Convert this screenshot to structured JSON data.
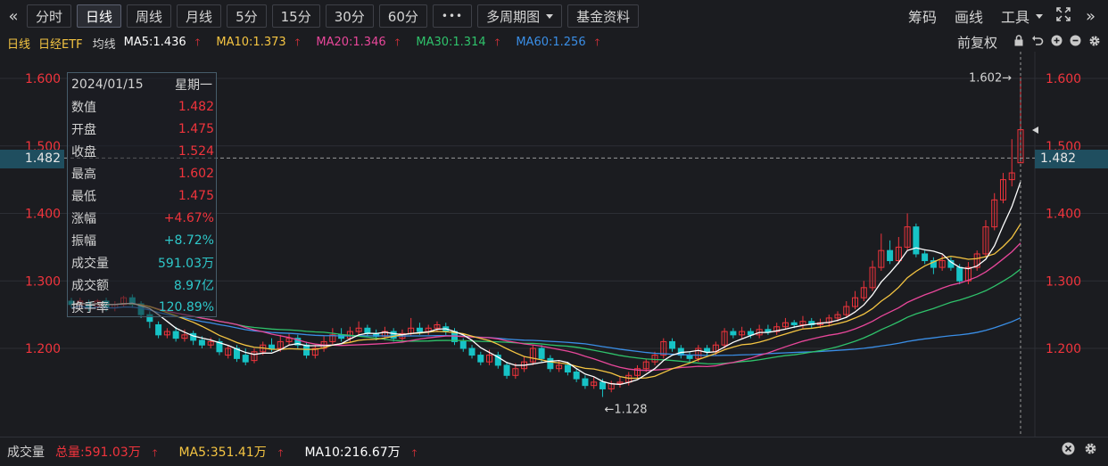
{
  "toolbar": {
    "collapse_icon": "«",
    "periods": [
      "分时",
      "日线",
      "周线",
      "月线",
      "5分",
      "15分",
      "30分",
      "60分"
    ],
    "active_period": "日线",
    "more": "•••",
    "multi_period": "多周期图",
    "fund_info": "基金资料",
    "right": [
      "筹码",
      "画线",
      "工具"
    ],
    "fullscreen_icon": "expand-icon",
    "expand_right_icon": "»"
  },
  "ma_legend": {
    "period": "日线",
    "name": "日经ETF",
    "ma_label": "均线",
    "items": [
      {
        "label": "MA5:1.436",
        "color": "#ffffff"
      },
      {
        "label": "MA10:1.373",
        "color": "#f5c542"
      },
      {
        "label": "MA20:1.346",
        "color": "#e8479a"
      },
      {
        "label": "MA30:1.314",
        "color": "#2fc26b"
      },
      {
        "label": "MA60:1.256",
        "color": "#3a8ee6"
      }
    ],
    "adjust": "前复权"
  },
  "tooltip": {
    "date": "2024/01/15",
    "weekday": "星期一",
    "rows": [
      {
        "k": "数值",
        "v": "1.482",
        "c": "red"
      },
      {
        "k": "开盘",
        "v": "1.475",
        "c": "red"
      },
      {
        "k": "收盘",
        "v": "1.524",
        "c": "red"
      },
      {
        "k": "最高",
        "v": "1.602",
        "c": "red"
      },
      {
        "k": "最低",
        "v": "1.475",
        "c": "red"
      },
      {
        "k": "涨幅",
        "v": "+4.67%",
        "c": "red"
      },
      {
        "k": "振幅",
        "v": "+8.72%",
        "c": "cyan"
      },
      {
        "k": "成交量",
        "v": "591.03万",
        "c": "cyan"
      },
      {
        "k": "成交额",
        "v": "8.97亿",
        "c": "cyan"
      },
      {
        "k": "换手率",
        "v": "120.89%",
        "c": "cyan"
      }
    ]
  },
  "crosshair_price": "1.482",
  "chart_data": {
    "type": "candlestick",
    "y_ticks": [
      "1.600",
      "1.500",
      "1.400",
      "1.300",
      "1.200"
    ],
    "ylim": [
      1.11,
      1.63
    ],
    "max_label": "1.602→",
    "min_label": "←1.128",
    "colors": {
      "up": "#f0343c",
      "down": "#17c3c6",
      "grid": "#2c2e35"
    },
    "candles": [
      [
        1.27,
        1.265,
        1.275,
        1.26
      ],
      [
        1.265,
        1.27,
        1.275,
        1.26
      ],
      [
        1.268,
        1.26,
        1.272,
        1.255
      ],
      [
        1.262,
        1.27,
        1.273,
        1.258
      ],
      [
        1.27,
        1.26,
        1.275,
        1.255
      ],
      [
        1.26,
        1.265,
        1.27,
        1.255
      ],
      [
        1.265,
        1.275,
        1.278,
        1.262
      ],
      [
        1.275,
        1.265,
        1.28,
        1.26
      ],
      [
        1.266,
        1.25,
        1.27,
        1.245
      ],
      [
        1.25,
        1.24,
        1.255,
        1.23
      ],
      [
        1.235,
        1.22,
        1.24,
        1.215
      ],
      [
        1.22,
        1.225,
        1.23,
        1.215
      ],
      [
        1.225,
        1.215,
        1.232,
        1.21
      ],
      [
        1.215,
        1.22,
        1.228,
        1.21
      ],
      [
        1.222,
        1.212,
        1.226,
        1.205
      ],
      [
        1.212,
        1.205,
        1.218,
        1.2
      ],
      [
        1.205,
        1.21,
        1.216,
        1.2
      ],
      [
        1.21,
        1.195,
        1.215,
        1.19
      ],
      [
        1.19,
        1.2,
        1.205,
        1.185
      ],
      [
        1.2,
        1.185,
        1.205,
        1.18
      ],
      [
        1.19,
        1.18,
        1.2,
        1.175
      ],
      [
        1.182,
        1.195,
        1.2,
        1.178
      ],
      [
        1.195,
        1.205,
        1.21,
        1.19
      ],
      [
        1.205,
        1.2,
        1.215,
        1.195
      ],
      [
        1.2,
        1.21,
        1.22,
        1.195
      ],
      [
        1.21,
        1.215,
        1.222,
        1.205
      ],
      [
        1.215,
        1.205,
        1.22,
        1.2
      ],
      [
        1.205,
        1.19,
        1.21,
        1.185
      ],
      [
        1.19,
        1.2,
        1.205,
        1.185
      ],
      [
        1.2,
        1.21,
        1.218,
        1.195
      ],
      [
        1.21,
        1.22,
        1.23,
        1.205
      ],
      [
        1.22,
        1.215,
        1.23,
        1.21
      ],
      [
        1.215,
        1.225,
        1.232,
        1.21
      ],
      [
        1.225,
        1.23,
        1.24,
        1.22
      ],
      [
        1.23,
        1.222,
        1.235,
        1.218
      ],
      [
        1.222,
        1.218,
        1.228,
        1.212
      ],
      [
        1.218,
        1.225,
        1.232,
        1.212
      ],
      [
        1.225,
        1.215,
        1.23,
        1.21
      ],
      [
        1.215,
        1.222,
        1.228,
        1.21
      ],
      [
        1.222,
        1.23,
        1.245,
        1.218
      ],
      [
        1.23,
        1.225,
        1.238,
        1.22
      ],
      [
        1.225,
        1.23,
        1.235,
        1.22
      ],
      [
        1.23,
        1.235,
        1.24,
        1.225
      ],
      [
        1.232,
        1.225,
        1.238,
        1.22
      ],
      [
        1.225,
        1.21,
        1.23,
        1.205
      ],
      [
        1.21,
        1.2,
        1.215,
        1.195
      ],
      [
        1.2,
        1.19,
        1.205,
        1.185
      ],
      [
        1.19,
        1.18,
        1.195,
        1.175
      ],
      [
        1.18,
        1.19,
        1.198,
        1.175
      ],
      [
        1.19,
        1.175,
        1.195,
        1.17
      ],
      [
        1.175,
        1.16,
        1.18,
        1.155
      ],
      [
        1.16,
        1.17,
        1.178,
        1.155
      ],
      [
        1.17,
        1.18,
        1.188,
        1.165
      ],
      [
        1.18,
        1.2,
        1.205,
        1.175
      ],
      [
        1.2,
        1.185,
        1.205,
        1.18
      ],
      [
        1.185,
        1.17,
        1.19,
        1.165
      ],
      [
        1.17,
        1.175,
        1.182,
        1.165
      ],
      [
        1.175,
        1.165,
        1.18,
        1.16
      ],
      [
        1.165,
        1.155,
        1.17,
        1.15
      ],
      [
        1.155,
        1.145,
        1.16,
        1.14
      ],
      [
        1.145,
        1.15,
        1.158,
        1.14
      ],
      [
        1.15,
        1.14,
        1.155,
        1.128
      ],
      [
        1.14,
        1.148,
        1.152,
        1.135
      ],
      [
        1.148,
        1.15,
        1.158,
        1.142
      ],
      [
        1.15,
        1.16,
        1.165,
        1.145
      ],
      [
        1.16,
        1.17,
        1.175,
        1.155
      ],
      [
        1.17,
        1.18,
        1.185,
        1.165
      ],
      [
        1.18,
        1.19,
        1.195,
        1.175
      ],
      [
        1.19,
        1.21,
        1.215,
        1.185
      ],
      [
        1.21,
        1.2,
        1.215,
        1.195
      ],
      [
        1.2,
        1.19,
        1.205,
        1.185
      ],
      [
        1.19,
        1.185,
        1.195,
        1.18
      ],
      [
        1.185,
        1.2,
        1.205,
        1.18
      ],
      [
        1.2,
        1.195,
        1.205,
        1.19
      ],
      [
        1.195,
        1.205,
        1.21,
        1.19
      ],
      [
        1.205,
        1.225,
        1.23,
        1.2
      ],
      [
        1.225,
        1.22,
        1.23,
        1.215
      ],
      [
        1.22,
        1.225,
        1.232,
        1.215
      ],
      [
        1.225,
        1.22,
        1.23,
        1.215
      ],
      [
        1.22,
        1.228,
        1.235,
        1.215
      ],
      [
        1.228,
        1.225,
        1.235,
        1.22
      ],
      [
        1.225,
        1.232,
        1.238,
        1.22
      ],
      [
        1.232,
        1.238,
        1.245,
        1.228
      ],
      [
        1.238,
        1.235,
        1.242,
        1.23
      ],
      [
        1.235,
        1.24,
        1.248,
        1.23
      ],
      [
        1.24,
        1.235,
        1.245,
        1.23
      ],
      [
        1.235,
        1.238,
        1.244,
        1.23
      ],
      [
        1.238,
        1.245,
        1.25,
        1.232
      ],
      [
        1.245,
        1.25,
        1.255,
        1.24
      ],
      [
        1.25,
        1.262,
        1.27,
        1.245
      ],
      [
        1.262,
        1.275,
        1.285,
        1.258
      ],
      [
        1.275,
        1.29,
        1.3,
        1.27
      ],
      [
        1.29,
        1.32,
        1.33,
        1.285
      ],
      [
        1.32,
        1.345,
        1.37,
        1.315
      ],
      [
        1.345,
        1.33,
        1.36,
        1.325
      ],
      [
        1.33,
        1.35,
        1.365,
        1.325
      ],
      [
        1.35,
        1.38,
        1.4,
        1.345
      ],
      [
        1.38,
        1.34,
        1.385,
        1.335
      ],
      [
        1.34,
        1.33,
        1.345,
        1.325
      ],
      [
        1.33,
        1.32,
        1.335,
        1.31
      ],
      [
        1.32,
        1.33,
        1.338,
        1.315
      ],
      [
        1.33,
        1.32,
        1.335,
        1.315
      ],
      [
        1.32,
        1.3,
        1.325,
        1.295
      ],
      [
        1.3,
        1.32,
        1.328,
        1.295
      ],
      [
        1.32,
        1.34,
        1.345,
        1.315
      ],
      [
        1.34,
        1.38,
        1.39,
        1.335
      ],
      [
        1.38,
        1.42,
        1.43,
        1.375
      ],
      [
        1.42,
        1.45,
        1.46,
        1.415
      ],
      [
        1.45,
        1.46,
        1.51,
        1.44
      ],
      [
        1.475,
        1.524,
        1.602,
        1.475
      ]
    ],
    "ma_series_sample": "MA5/MA10/MA20/MA30/MA60 smoothed lines"
  },
  "volume_bar": {
    "label": "成交量",
    "total": "总量:591.03万",
    "ma5": "MA5:351.41万",
    "ma10": "MA10:216.67万"
  }
}
